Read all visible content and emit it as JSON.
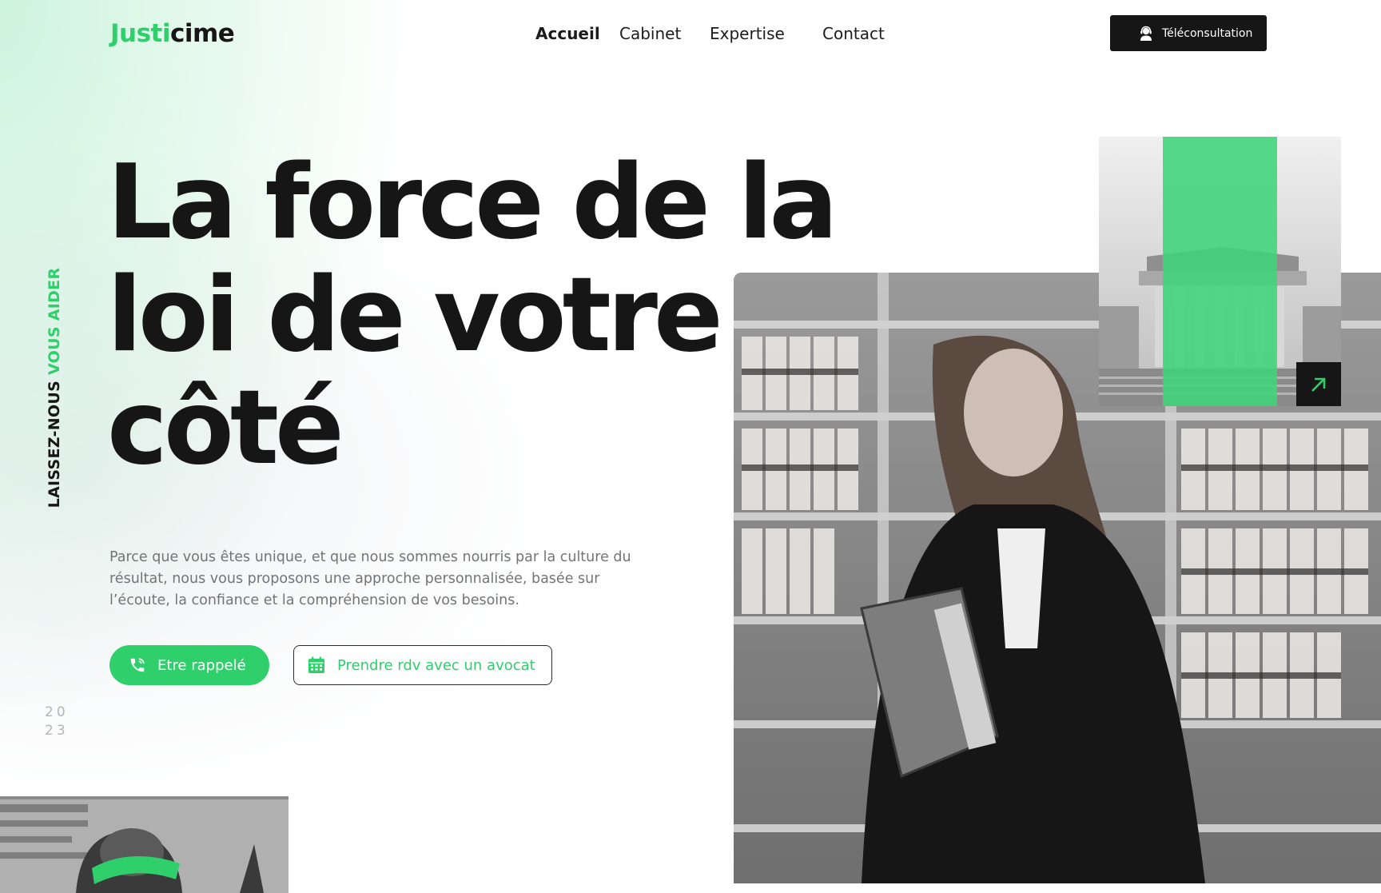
{
  "header": {
    "logo": {
      "part1": "Justi",
      "part2": "cime"
    },
    "nav": [
      {
        "label": "Accueil",
        "active": true
      },
      {
        "label": "Cabinet",
        "active": false
      },
      {
        "label": "Expertise",
        "active": false
      },
      {
        "label": "Contact",
        "active": false
      }
    ],
    "cta": {
      "label": "Téléconsultation",
      "icon": "headset-icon"
    }
  },
  "hero": {
    "title_lines": [
      "La force de la",
      "loi de votre",
      "côté"
    ],
    "vertical_tag": {
      "dark": "LAISSEZ-NOUS ",
      "green": "VOUS AIDER"
    },
    "description": "Parce que vous êtes unique, et que nous sommes nourris par la culture du résultat, nous vous proposons une approche personnalisée, basée sur l’écoute, la confiance et la compréhension de vos besoins.",
    "primary_button": {
      "label": "Etre rappelé",
      "icon": "phone-icon"
    },
    "secondary_button": {
      "label": "Prendre rdv avec un avocat",
      "icon": "calendar-icon"
    },
    "year": [
      "20",
      "23"
    ]
  },
  "images": {
    "lawyer_photo": "lawyer-portrait",
    "court_photo": "supreme-court-building",
    "statue_photo": "statue-blindfold",
    "arrow_icon": "arrow-up-right-icon"
  },
  "colors": {
    "accent": "#2fcf6b",
    "dark": "#161616",
    "muted_text": "#747474"
  }
}
